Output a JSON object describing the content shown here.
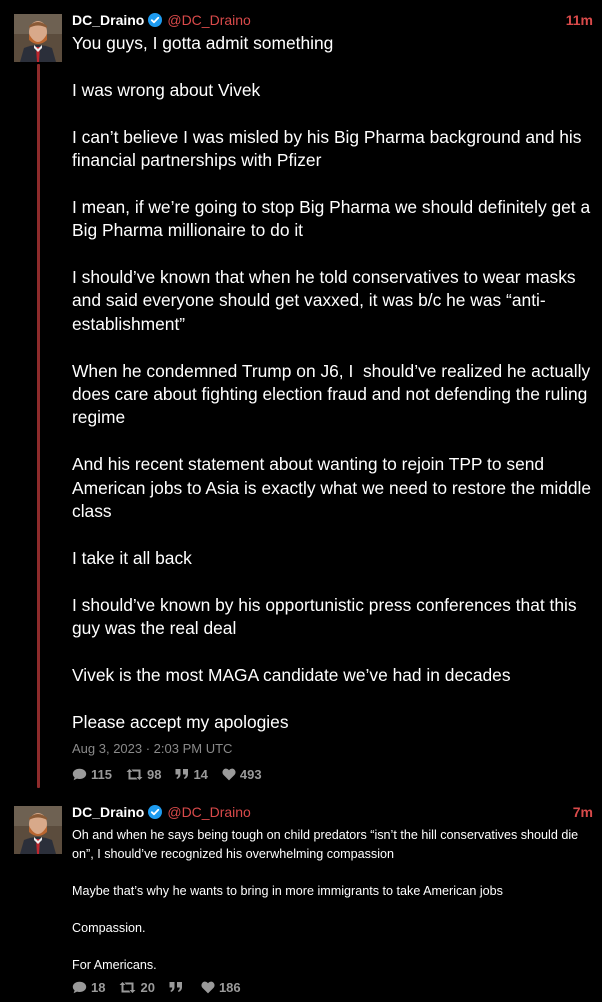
{
  "tweet1": {
    "display_name": "DC_Draino",
    "handle": "@DC_Draino",
    "time_ago": "11m",
    "paragraphs": [
      "You guys, I gotta admit something",
      "I was wrong about Vivek",
      "I can’t believe I was misled by his Big Pharma background and his financial partnerships with Pfizer",
      "I mean, if we’re going to stop Big Pharma we should definitely get a Big Pharma millionaire to do it",
      "I should’ve known that when he told conservatives to wear masks and said everyone should get vaxxed, it was b/c he was “anti-establishment”",
      "When he condemned Trump on J6, I  should’ve realized he actually does care about fighting election fraud and not defending the ruling regime",
      "And his recent statement about wanting to rejoin TPP to send American jobs to Asia is exactly what we need to restore the middle class",
      "I take it all back",
      "I should’ve known by his opportunistic press conferences that this guy was the real deal",
      "Vivek is the most MAGA candidate we’ve had in decades",
      "Please accept my apologies"
    ],
    "date": "Aug 3, 2023 · 2:03 PM UTC",
    "stats": {
      "replies": "115",
      "retweets": "98",
      "quotes": "14",
      "likes": "493"
    }
  },
  "tweet2": {
    "display_name": "DC_Draino",
    "handle": "@DC_Draino",
    "time_ago": "7m",
    "paragraphs": [
      "Oh and when he says being tough on child predators “isn’t the hill conservatives should die on”, I should’ve recognized his overwhelming compassion",
      "Maybe that’s why he wants to bring in more immigrants to take American jobs",
      "Compassion.",
      "For Americans."
    ],
    "stats": {
      "replies": "18",
      "retweets": "20",
      "quotes": "",
      "likes": "186"
    }
  },
  "icons": {
    "verified": "verified-badge-icon",
    "reply": "comment-icon",
    "retweet": "retweet-icon",
    "quote": "quote-icon",
    "like": "heart-icon"
  },
  "colors": {
    "background": "#000000",
    "accent_red": "#d94a4a",
    "thread_line": "#8e2b2b",
    "verified_blue": "#1d9bf0",
    "muted": "#8a8a8a"
  }
}
